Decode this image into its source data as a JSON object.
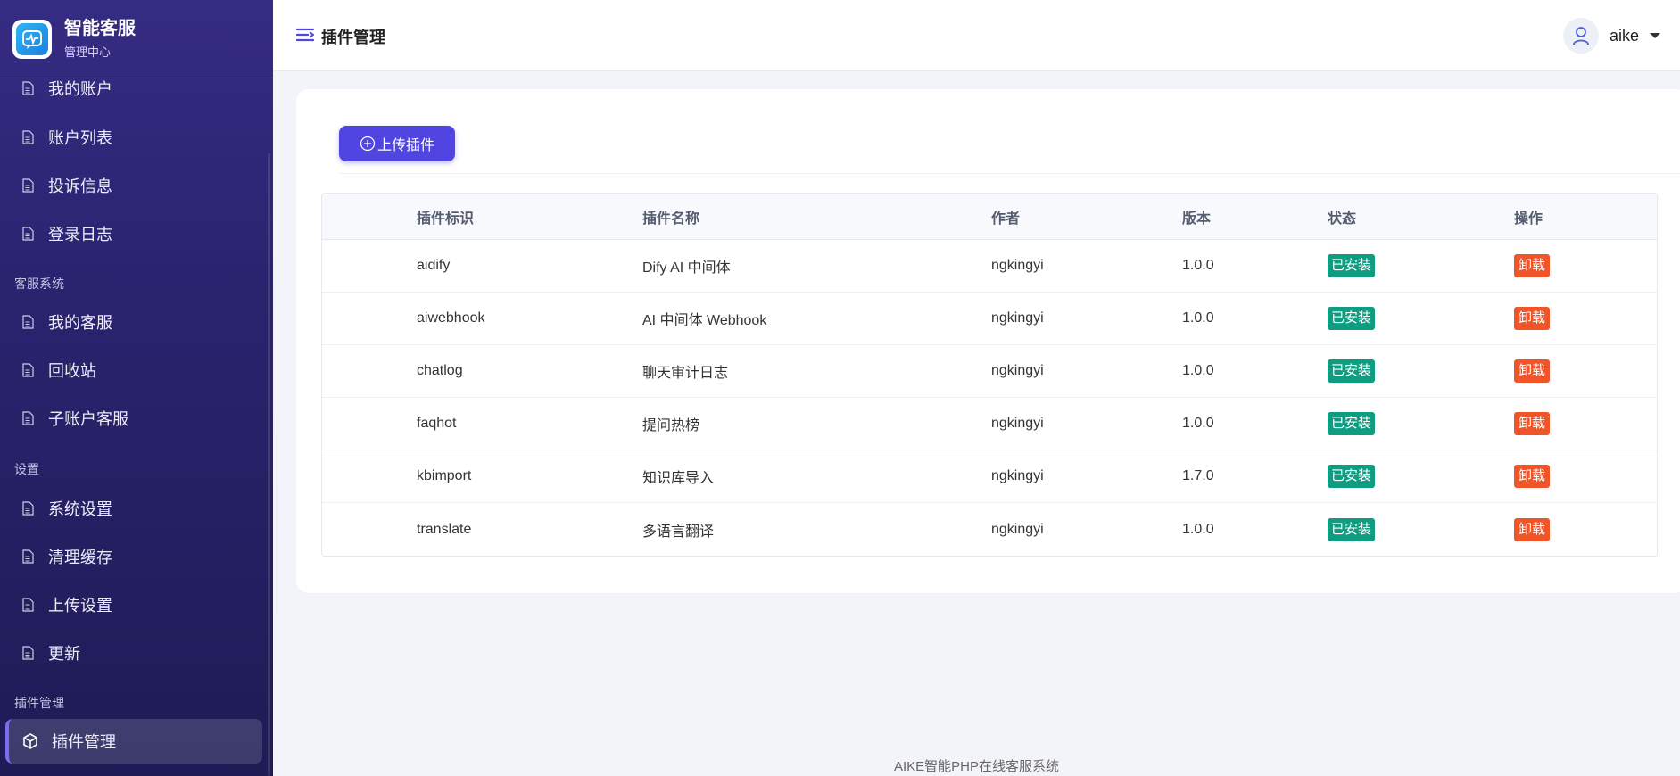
{
  "brand": {
    "title": "智能客服",
    "subtitle": "管理中心"
  },
  "sidebar": {
    "items_top": [
      {
        "label": "我的账户"
      },
      {
        "label": "账户列表"
      },
      {
        "label": "投诉信息"
      },
      {
        "label": "登录日志"
      }
    ],
    "section_service": "客服系统",
    "items_service": [
      {
        "label": "我的客服"
      },
      {
        "label": "回收站"
      },
      {
        "label": "子账户客服"
      }
    ],
    "section_settings": "设置",
    "items_settings": [
      {
        "label": "系统设置"
      },
      {
        "label": "清理缓存"
      },
      {
        "label": "上传设置"
      },
      {
        "label": "更新"
      }
    ],
    "section_plugins": "插件管理",
    "active_item": {
      "label": "插件管理"
    }
  },
  "header": {
    "title": "插件管理",
    "username": "aike"
  },
  "toolbar": {
    "upload_label": "上传插件"
  },
  "table": {
    "columns": [
      "插件标识",
      "插件名称",
      "作者",
      "版本",
      "状态",
      "操作"
    ],
    "rows": [
      {
        "id": "aidify",
        "name": "Dify AI 中间体",
        "author": "ngkingyi",
        "version": "1.0.0",
        "status": "已安装",
        "action": "卸载"
      },
      {
        "id": "aiwebhook",
        "name": "AI 中间体 Webhook",
        "author": "ngkingyi",
        "version": "1.0.0",
        "status": "已安装",
        "action": "卸载"
      },
      {
        "id": "chatlog",
        "name": "聊天审计日志",
        "author": "ngkingyi",
        "version": "1.0.0",
        "status": "已安装",
        "action": "卸载"
      },
      {
        "id": "faqhot",
        "name": "提问热榜",
        "author": "ngkingyi",
        "version": "1.0.0",
        "status": "已安装",
        "action": "卸载"
      },
      {
        "id": "kbimport",
        "name": "知识库导入",
        "author": "ngkingyi",
        "version": "1.7.0",
        "status": "已安装",
        "action": "卸载"
      },
      {
        "id": "translate",
        "name": "多语言翻译",
        "author": "ngkingyi",
        "version": "1.0.0",
        "status": "已安装",
        "action": "卸载"
      }
    ]
  },
  "footer": {
    "text": "AIKE智能PHP在线客服系统"
  },
  "colors": {
    "accent": "#5045e0",
    "installed": "#0f9d82",
    "uninstall": "#f0552a",
    "sidebar": "#2a2470"
  }
}
